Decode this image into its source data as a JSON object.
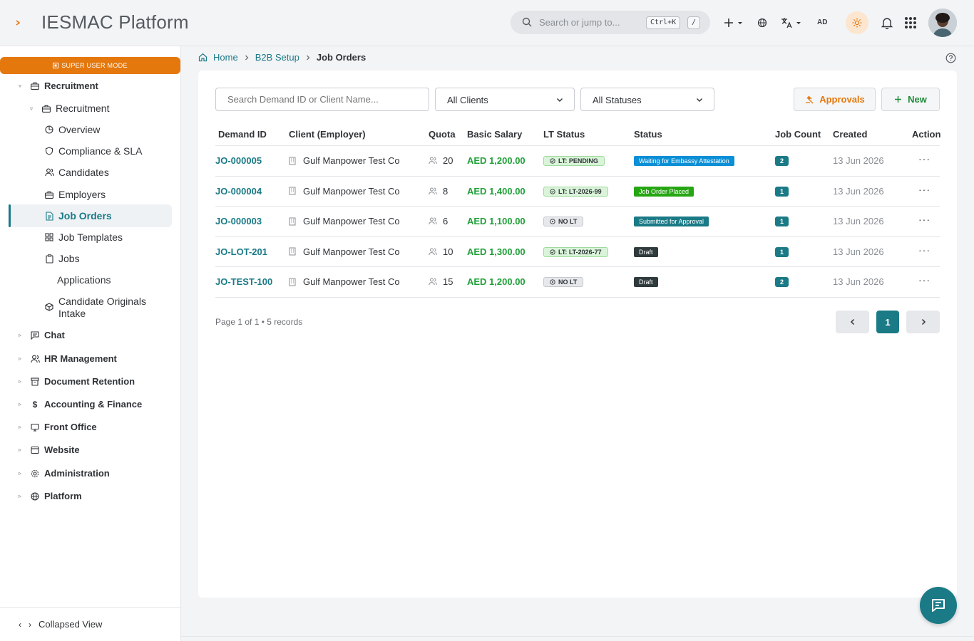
{
  "app": {
    "title": "IESMAC Platform"
  },
  "header": {
    "search_placeholder": "Search or jump to...",
    "shortcut_key": "Ctrl+K",
    "shortcut_slash": "/",
    "user_initials": "AD"
  },
  "sidebar": {
    "super_user_label": "SUPER USER MODE",
    "recruitment_group": "Recruitment",
    "recruitment_sub": "Recruitment",
    "items": [
      {
        "label": "Overview",
        "icon": "pie-chart-icon"
      },
      {
        "label": "Compliance & SLA",
        "icon": "shield-icon"
      },
      {
        "label": "Candidates",
        "icon": "users-icon"
      },
      {
        "label": "Employers",
        "icon": "briefcase-icon"
      },
      {
        "label": "Job Orders",
        "icon": "document-icon",
        "active": true
      },
      {
        "label": "Job Templates",
        "icon": "grid-icon"
      },
      {
        "label": "Jobs",
        "icon": "clipboard-icon"
      },
      {
        "label": "Applications",
        "icon": ""
      },
      {
        "label": "Candidate Originals Intake",
        "icon": "box-icon"
      }
    ],
    "groups": [
      {
        "label": "Chat",
        "icon": "message-icon"
      },
      {
        "label": "HR Management",
        "icon": "users-icon"
      },
      {
        "label": "Document Retention",
        "icon": "archive-icon"
      },
      {
        "label": "Accounting & Finance",
        "icon": "dollar-icon"
      },
      {
        "label": "Front Office",
        "icon": "monitor-icon"
      },
      {
        "label": "Website",
        "icon": "browser-icon"
      },
      {
        "label": "Administration",
        "icon": "settings-icon"
      },
      {
        "label": "Platform",
        "icon": "globe-icon"
      }
    ],
    "collapse_label": "Collapsed View"
  },
  "breadcrumb": {
    "home": "Home",
    "section": "B2B Setup",
    "current": "Job Orders"
  },
  "filters": {
    "search_placeholder": "Search Demand ID or Client Name...",
    "clients_value": "All Clients",
    "statuses_value": "All Statuses",
    "approvals_label": "Approvals",
    "new_label": "New"
  },
  "table": {
    "headers": [
      "Demand ID",
      "Client (Employer)",
      "Quota",
      "Basic Salary",
      "LT Status",
      "Status",
      "Job Count",
      "Created",
      "Action"
    ],
    "rows": [
      {
        "id": "JO-000005",
        "client": "Gulf Manpower Test Co",
        "quota": "20",
        "salary": "AED 1,200.00",
        "lt": "LT: PENDING",
        "lt_kind": "green",
        "status": "Waiting for Embassy Attestation",
        "status_color": "#0b8fd6",
        "count": "2",
        "created": "13 Jun 2026"
      },
      {
        "id": "JO-000004",
        "client": "Gulf Manpower Test Co",
        "quota": "8",
        "salary": "AED 1,400.00",
        "lt": "LT: LT-2026-99",
        "lt_kind": "green",
        "status": "Job Order Placed",
        "status_color": "#27a613",
        "count": "1",
        "created": "13 Jun 2026"
      },
      {
        "id": "JO-000003",
        "client": "Gulf Manpower Test Co",
        "quota": "6",
        "salary": "AED 1,100.00",
        "lt": "NO LT",
        "lt_kind": "gray",
        "status": "Submitted for Approval",
        "status_color": "#1a7a86",
        "count": "1",
        "created": "13 Jun 2026"
      },
      {
        "id": "JO-LOT-201",
        "client": "Gulf Manpower Test Co",
        "quota": "10",
        "salary": "AED 1,300.00",
        "lt": "LT: LT-2026-77",
        "lt_kind": "green",
        "status": "Draft",
        "status_color": "#2f3a3d",
        "count": "1",
        "created": "13 Jun 2026"
      },
      {
        "id": "JO-TEST-100",
        "client": "Gulf Manpower Test Co",
        "quota": "15",
        "salary": "AED 1,200.00",
        "lt": "NO LT",
        "lt_kind": "gray",
        "status": "Draft",
        "status_color": "#2f3a3d",
        "count": "2",
        "created": "13 Jun 2026"
      }
    ]
  },
  "pagination": {
    "info": "Page 1 of 1 • 5 records",
    "current": "1"
  },
  "colors": {
    "accent": "#1a7a86",
    "warning": "#e5780d",
    "money": "#21a03a"
  }
}
